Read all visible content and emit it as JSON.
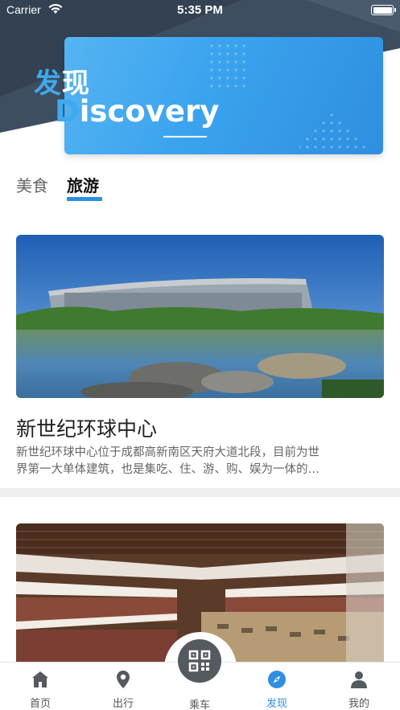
{
  "status_bar": {
    "carrier": "Carrier",
    "time": "5:35 PM"
  },
  "banner": {
    "title_cn_first": "发",
    "title_cn_rest": "现",
    "title_en_first": "D",
    "title_en_rest": "iscovery"
  },
  "tabs": [
    {
      "label": "美食",
      "active": false
    },
    {
      "label": "旅游",
      "active": true
    }
  ],
  "cards": [
    {
      "title": "新世纪环球中心",
      "desc_line1": "新世纪环球中心位于成都高新南区天府大道北段，目前为世",
      "desc_line2": "界第一大单体建筑，也是集吃、住、游、购、娱为一体的…"
    }
  ],
  "tab_bar": {
    "items": [
      {
        "label": "首页",
        "icon": "home-icon"
      },
      {
        "label": "出行",
        "icon": "location-pin-icon"
      },
      {
        "label": "乘车",
        "icon": "qr-code-icon"
      },
      {
        "label": "发现",
        "icon": "compass-icon",
        "active": true
      },
      {
        "label": "我的",
        "icon": "user-icon"
      }
    ]
  },
  "colors": {
    "accent": "#2f8ee0",
    "header_dark": "#3e4e60",
    "divider": "#efefef"
  }
}
